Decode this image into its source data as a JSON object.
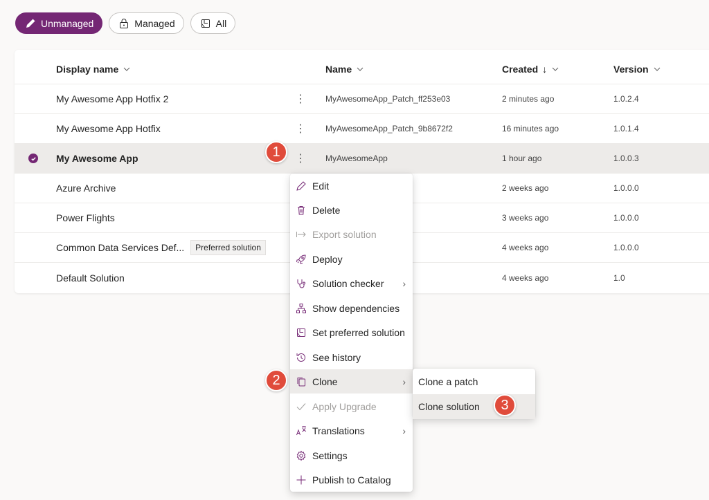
{
  "filters": {
    "unmanaged": "Unmanaged",
    "managed": "Managed",
    "all": "All"
  },
  "table": {
    "headers": {
      "display_name": "Display name",
      "name": "Name",
      "created": "Created",
      "created_sort": "↓",
      "version": "Version"
    },
    "rows": [
      {
        "display_name": "My Awesome App Hotfix 2",
        "name": "MyAwesomeApp_Patch_ff253e03",
        "created": "2 minutes ago",
        "version": "1.0.2.4",
        "more": "⋮"
      },
      {
        "display_name": "My Awesome App Hotfix",
        "name": "MyAwesomeApp_Patch_9b8672f2",
        "created": "16 minutes ago",
        "version": "1.0.1.4",
        "more": "⋮"
      },
      {
        "display_name": "My Awesome App",
        "name": "MyAwesomeApp",
        "created": "1 hour ago",
        "version": "1.0.0.3",
        "more": "⋮",
        "selected": true
      },
      {
        "display_name": "Azure Archive",
        "name": "",
        "created": "2 weeks ago",
        "version": "1.0.0.0"
      },
      {
        "display_name": "Power Flights",
        "name": "",
        "created": "3 weeks ago",
        "version": "1.0.0.0"
      },
      {
        "display_name": "Common Data Services Def...",
        "badge": "Preferred solution",
        "name": "",
        "created": "4 weeks ago",
        "version": "1.0.0.0"
      },
      {
        "display_name": "Default Solution",
        "name": "",
        "created": "4 weeks ago",
        "version": "1.0"
      }
    ]
  },
  "context_menu": {
    "items": [
      {
        "label": "Edit",
        "icon": "pencil-icon"
      },
      {
        "label": "Delete",
        "icon": "trash-icon"
      },
      {
        "label": "Export solution",
        "icon": "export-arrow-icon",
        "disabled": true
      },
      {
        "label": "Deploy",
        "icon": "rocket-icon"
      },
      {
        "label": "Solution checker",
        "icon": "stethoscope-icon",
        "submenu": true
      },
      {
        "label": "Show dependencies",
        "icon": "hierarchy-icon"
      },
      {
        "label": "Set preferred solution",
        "icon": "preferred-icon"
      },
      {
        "label": "See history",
        "icon": "history-icon"
      },
      {
        "label": "Clone",
        "icon": "copy-icon",
        "submenu": true,
        "hover": true
      },
      {
        "label": "Apply Upgrade",
        "icon": "checkmark-icon",
        "disabled": true
      },
      {
        "label": "Translations",
        "icon": "translate-icon",
        "submenu": true
      },
      {
        "label": "Settings",
        "icon": "gear-icon"
      },
      {
        "label": "Publish to Catalog",
        "icon": "plus-icon"
      }
    ],
    "submenu_arrow": "›"
  },
  "clone_submenu": {
    "items": [
      {
        "label": "Clone a patch"
      },
      {
        "label": "Clone solution"
      }
    ]
  },
  "steps": [
    "1",
    "2",
    "3"
  ],
  "colors": {
    "accent": "#742774",
    "step": "#e04b3b",
    "hover": "#edebe9"
  }
}
